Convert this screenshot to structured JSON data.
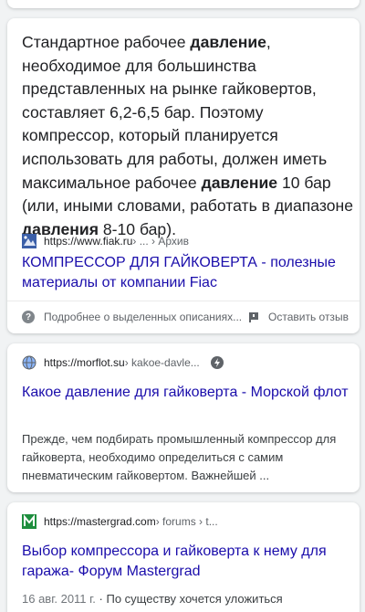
{
  "featured": {
    "snippet_parts": [
      {
        "text": "Стандартное рабочее ",
        "bold": false
      },
      {
        "text": "давление",
        "bold": true
      },
      {
        "text": ", необходимое для большинства представленных на рынке гайковертов, составляет 6,2-6,5 бар. Поэтому компрессор, который планируется использовать для работы, должен иметь максимальное рабочее ",
        "bold": false
      },
      {
        "text": "давление",
        "bold": true
      },
      {
        "text": " 10 бар (или, иными словами, работать в диапазоне ",
        "bold": false
      },
      {
        "text": "давления",
        "bold": true
      },
      {
        "text": " 8-10 бар).",
        "bold": false
      }
    ],
    "source_url": "https://www.fiak.ru",
    "source_path": " › ... › Архив",
    "title": "КОМПРЕССОР ДЛЯ ГАЙКОВЕРТА - полезные материалы от компании Fiac",
    "footer_left": "Подробнее о выделенных описаниях...",
    "footer_right": "Оставить отзыв"
  },
  "results": [
    {
      "url": "https://morflot.su",
      "path": " › kakoe-davle...",
      "title": "Какое давление для гайковерта - Морской флот",
      "desc": "Прежде, чем подбирать промышленный компрессор для гайковерта, необходимо определиться с самим пневматическим гайковертом. Важнейшей ..."
    },
    {
      "url": "https://mastergrad.com",
      "path": " › forums › t...",
      "title": "Выбор компрессора и гайковерта к нему для гаража- Форум Mastergrad",
      "date": "16 авг. 2011 г.",
      "desc": " · По существу хочется уложиться"
    }
  ],
  "colors": {
    "link": "#1a0dab",
    "background": "#f1f3f4",
    "mastergrad_green": "#1e8e3e"
  }
}
